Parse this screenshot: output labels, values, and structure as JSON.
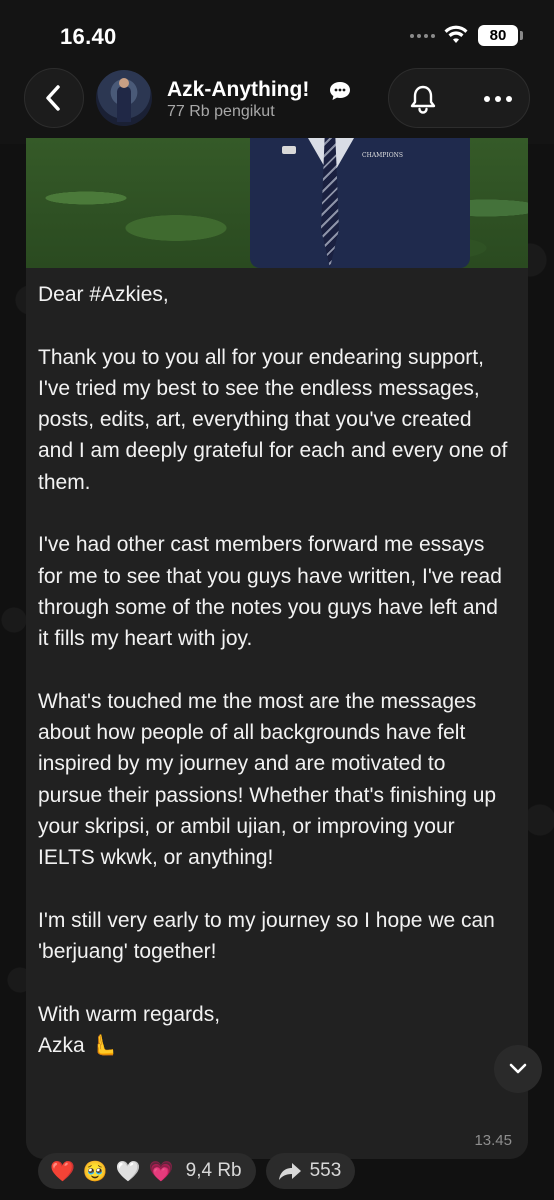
{
  "status_bar": {
    "time": "16.40",
    "battery": "80"
  },
  "header": {
    "channel_name": "Azk-Anything!",
    "followers": "77 Rb pengikut"
  },
  "message": {
    "text": "Dear #Azkies,\n\nThank you to you all for your endearing support, I've tried my best to see the endless messages, posts, edits, art, everything that you've created and I am deeply grateful for each and every one of them.\n\nI've had other cast members forward me essays for me to see that you guys have written, I've read through some of the notes you guys have left and it fills my heart with joy.\n\nWhat's touched me the most are the messages about how people of all backgrounds have felt inspired by my journey and are motivated to pursue their passions! Whether that's finishing up your skripsi, or ambil ujian, or improving your IELTS wkwk, or anything!\n\nI'm still very early to my journey so I hope we can 'berjuang' together!\n\nWith warm regards,\nAzka 🫷",
    "time": "13.45",
    "photo_badge": "CHAMPIONS"
  },
  "reactions": {
    "emojis": [
      "❤️",
      "🥹",
      "🤍",
      "💗"
    ],
    "count": "9,4 Rb",
    "share_count": "553"
  },
  "icons": {
    "back": "back-arrow-icon",
    "bell": "bell-icon",
    "more": "more-dots-icon",
    "share": "share-arrow-icon",
    "scroll": "chevron-down-icon"
  }
}
